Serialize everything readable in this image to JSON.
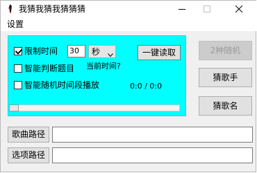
{
  "window": {
    "title": "我猜我猜我猜猜猜"
  },
  "menu": {
    "items": [
      "设置"
    ]
  },
  "panel": {
    "limit_time": {
      "label": "限制时间",
      "checked": true,
      "value": "30",
      "unit": "秒"
    },
    "smart_judge": {
      "label": "智能判断题目",
      "checked": false
    },
    "smart_random": {
      "label": "智能随机时间段播放",
      "checked": false
    },
    "read_button": "一键读取",
    "current_time_label": "当前时间?",
    "time_readout": "0:0 / 0:0",
    "progress": 0.0
  },
  "side_buttons": {
    "random2": "2种随机",
    "guess_singer": "猜歌手",
    "guess_song": "猜歌名"
  },
  "paths": {
    "song_label": "歌曲路径",
    "song_value": "",
    "option_label": "选项路径",
    "option_value": ""
  },
  "colors": {
    "panel_bg": "#00ffff"
  },
  "icons": {
    "app": "pen-icon",
    "minimize": "minimize-icon",
    "maximize": "maximize-icon",
    "close": "close-icon"
  }
}
